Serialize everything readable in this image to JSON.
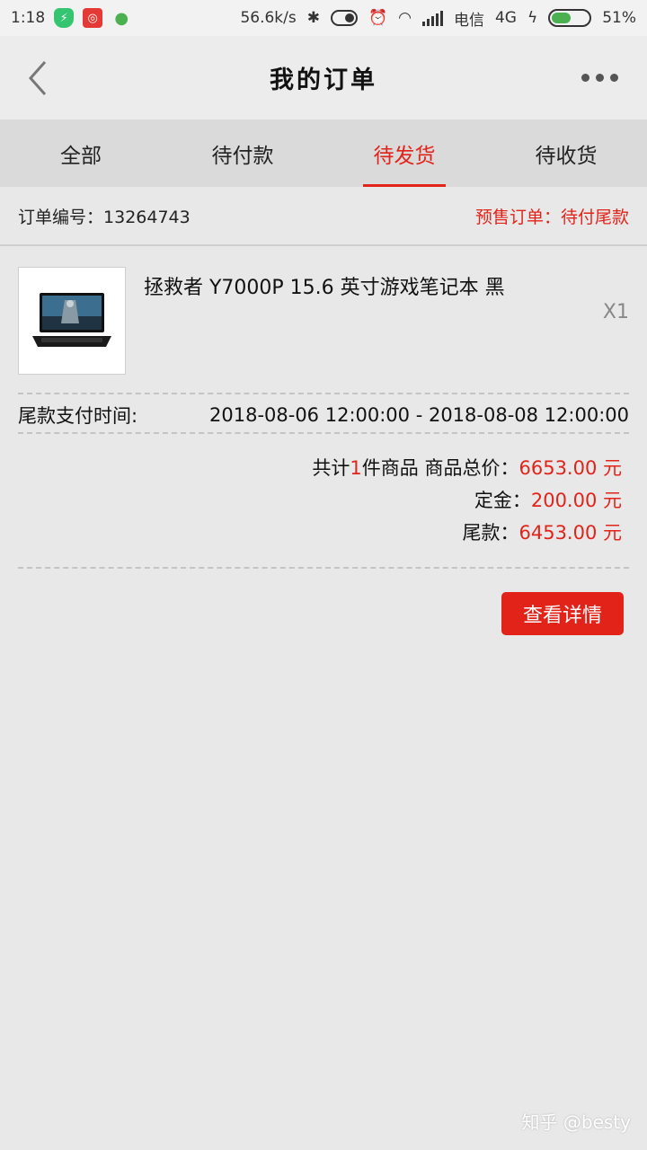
{
  "status_bar": {
    "time": "1:18",
    "net_speed": "56.6k/s",
    "carrier": "电信",
    "network_type": "4G",
    "battery_percent": 51,
    "battery_text": "51%"
  },
  "header": {
    "title": "我的订单",
    "back_icon": "chevron-left-icon",
    "more_icon": "more-dots-icon"
  },
  "tabs": [
    {
      "label": "全部",
      "active": false
    },
    {
      "label": "待付款",
      "active": false
    },
    {
      "label": "待发货",
      "active": true
    },
    {
      "label": "待收货",
      "active": false
    }
  ],
  "order": {
    "number_label": "订单编号：",
    "number": "13264743",
    "status": "预售订单：待付尾款"
  },
  "product": {
    "name": "拯救者 Y7000P 15.6 英寸游戏笔记本 黑",
    "quantity": "X1"
  },
  "payment": {
    "label": "尾款支付时间:",
    "range": "2018-08-06 12:00:00 - 2018-08-08 12:00:00"
  },
  "totals": {
    "count_prefix": "共计",
    "count": "1",
    "count_suffix": "件商品 商品总价：",
    "total": "6653.00 元",
    "deposit_label": "定金：",
    "deposit": "200.00 元",
    "balance_label": "尾款：",
    "balance": "6453.00 元"
  },
  "actions": {
    "detail_button": "查看详情"
  },
  "watermark": "知乎 @besty",
  "colors": {
    "accent": "#e2231a",
    "background": "#e8e8e8"
  }
}
